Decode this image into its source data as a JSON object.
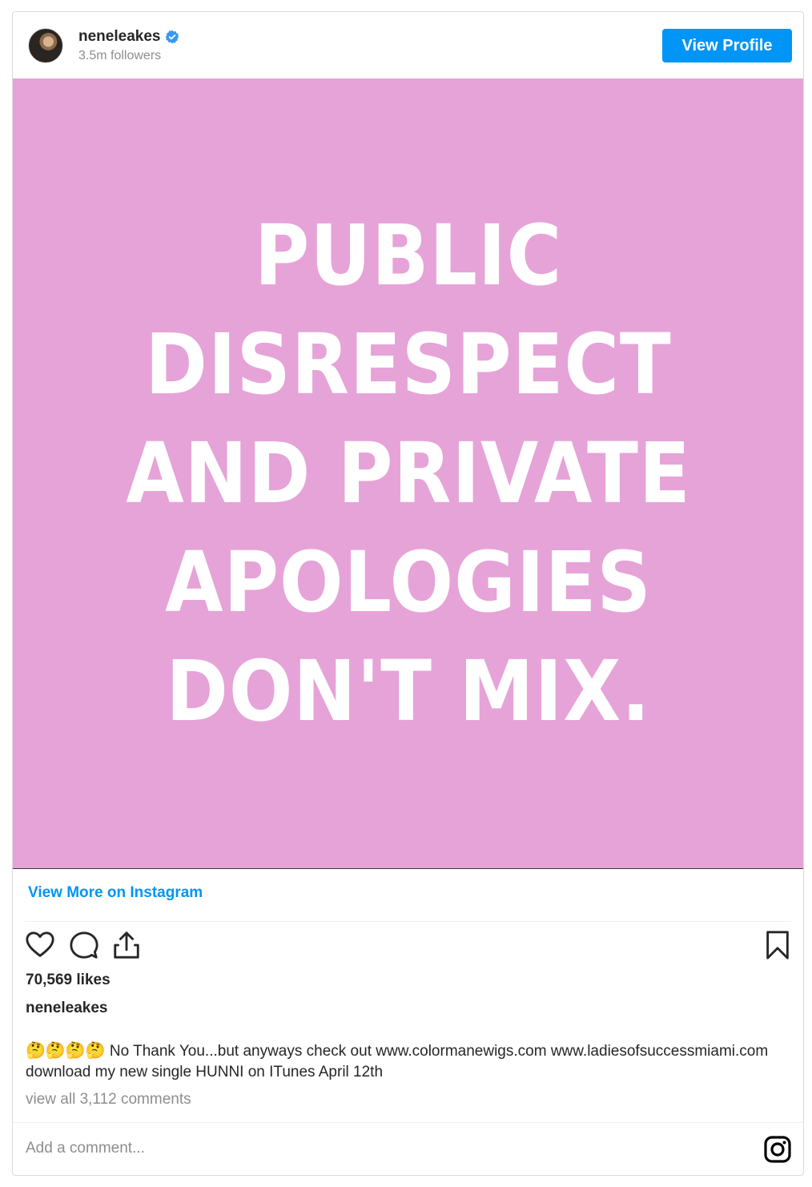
{
  "header": {
    "username": "neneleakes",
    "followers": "3.5m followers",
    "view_profile_label": "View Profile"
  },
  "post": {
    "image_lines": [
      "PUBLIC",
      "DISRESPECT",
      "AND PRIVATE",
      "APOLOGIES",
      "DON'T MIX."
    ],
    "background_color": "#e6a3d8"
  },
  "links": {
    "view_more": "View More on Instagram"
  },
  "actions": {
    "icons": [
      "heart-icon",
      "comment-icon",
      "share-icon",
      "bookmark-icon"
    ]
  },
  "stats": {
    "likes": "70,569 likes"
  },
  "caption": {
    "username": "neneleakes",
    "emojis": "🤔🤔🤔🤔",
    "text": " No Thank You...but anyways check out www.colormanewigs.com www.ladiesofsuccessmiami.com download my new single HUNNI on ITunes April 12th"
  },
  "comments": {
    "view_all": "view all 3,112 comments",
    "placeholder": "Add a comment..."
  },
  "colors": {
    "accent": "#0095f6",
    "muted": "#8e8e8e"
  }
}
